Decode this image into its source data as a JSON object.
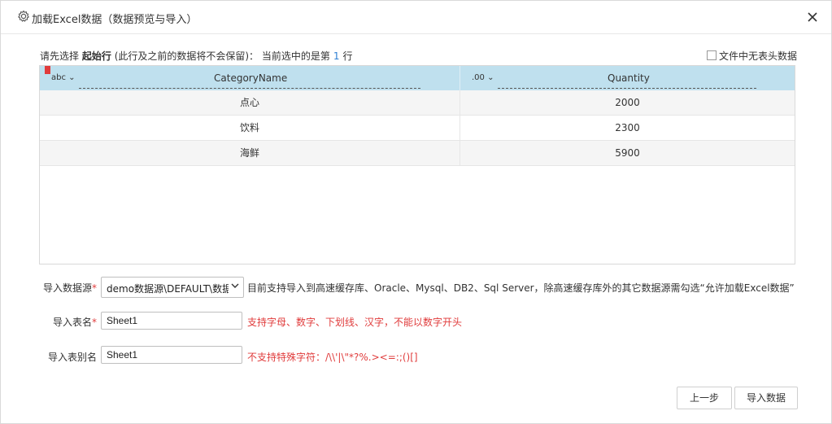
{
  "dialog": {
    "title": "加载Excel数据（数据预览与导入）"
  },
  "hint": {
    "prefix": "请先选择",
    "bold": "起始行",
    "middle": "(此行及之前的数据将不会保留)：  当前选中的是第",
    "row_number": "1",
    "suffix": "行"
  },
  "options": {
    "no_header_label": "文件中无表头数据",
    "no_header_checked": false
  },
  "grid": {
    "columns": [
      {
        "type": "abc",
        "name": "CategoryName"
      },
      {
        "type": ".00",
        "name": "Quantity"
      }
    ],
    "rows": [
      [
        "点心",
        "2000"
      ],
      [
        "饮料",
        "2300"
      ],
      [
        "海鲜",
        "5900"
      ]
    ]
  },
  "form": {
    "datasource_label": "导入数据源",
    "datasource_value": "demo数据源\\DEFAULT\\数据",
    "datasource_note": "目前支持导入到高速缓存库、Oracle、Mysql、DB2、Sql Server，除高速缓存库外的其它数据源需勾选“允许加载Excel数据”",
    "table_name_label": "导入表名",
    "table_name_value": "Sheet1",
    "table_name_note": "支持字母、数字、下划线、汉字，不能以数字开头",
    "alias_label": "导入表别名",
    "alias_value": "Sheet1",
    "alias_note": "不支持特殊字符：/\\\\'|\\\"*?%.><=:;()[]",
    "required_mark": "*"
  },
  "buttons": {
    "prev": "上一步",
    "import": "导入数据"
  },
  "colors": {
    "header_bg": "#bfe0ee",
    "required": "#e03c3c",
    "accent": "#2f7fd3"
  }
}
